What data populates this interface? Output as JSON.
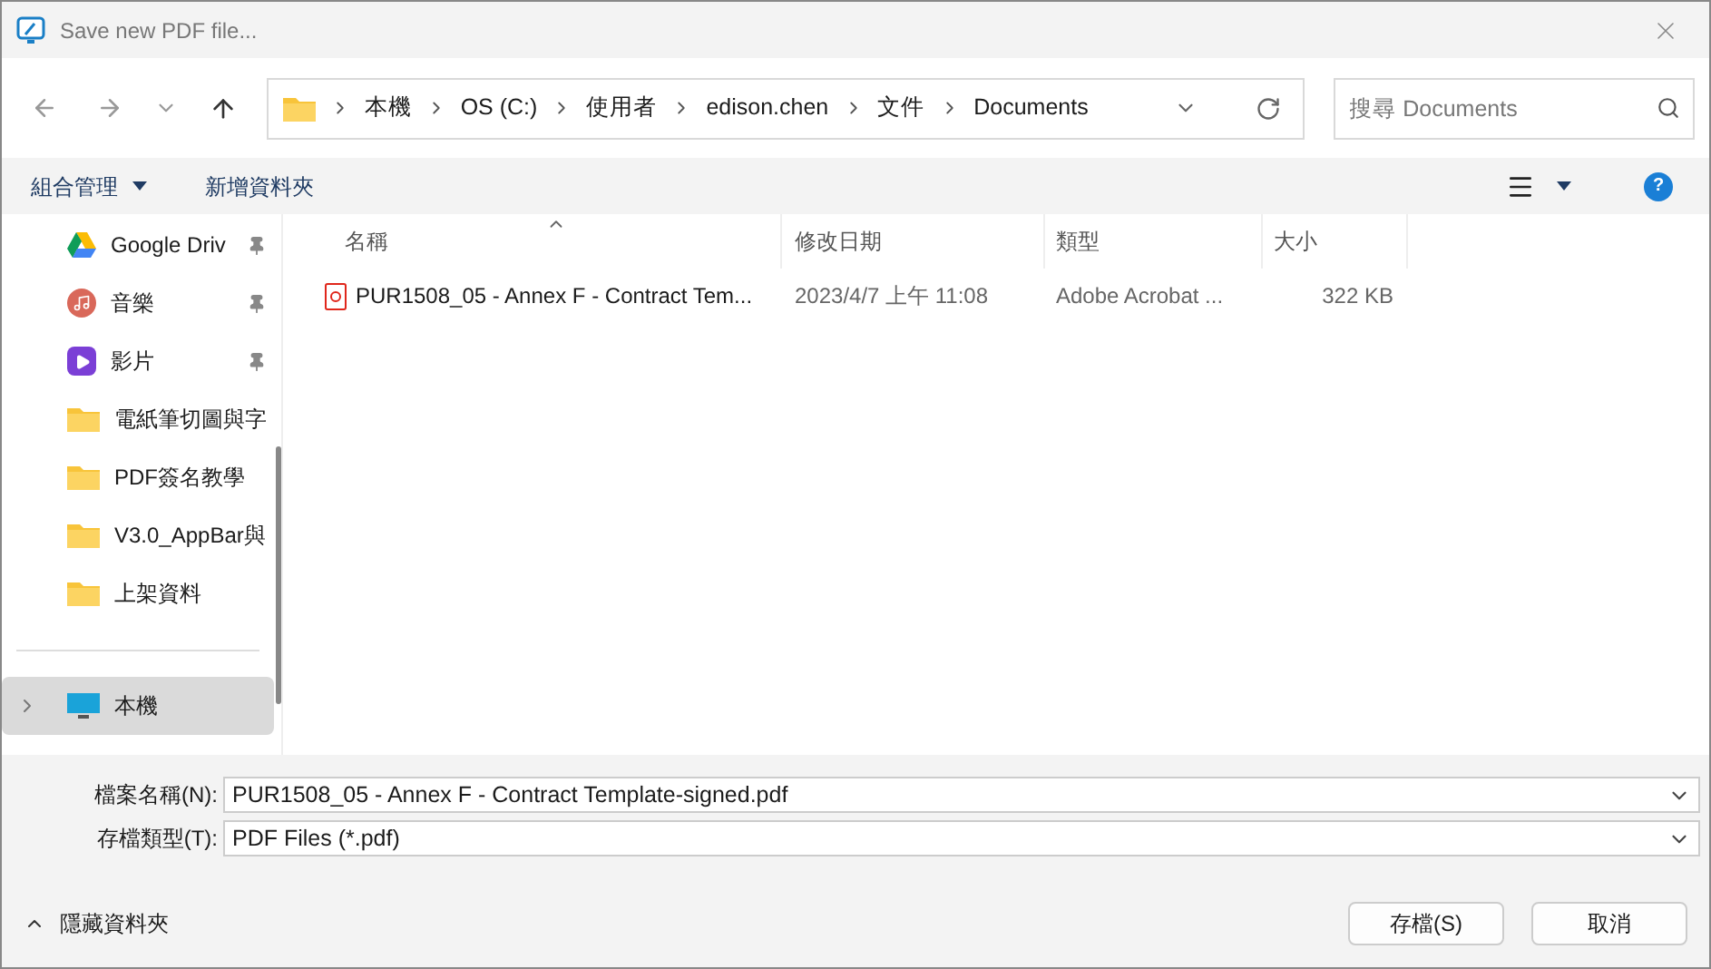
{
  "window": {
    "title": "Save new PDF file..."
  },
  "address_bar": {
    "path": [
      "本機",
      "OS (C:)",
      "使用者",
      "edison.chen",
      "文件",
      "Documents"
    ]
  },
  "search": {
    "placeholder": "搜尋 Documents"
  },
  "toolbar": {
    "organize": "組合管理",
    "new_folder": "新增資料夾",
    "help": "?"
  },
  "sidebar": {
    "items": [
      {
        "kind": "drive",
        "label": "Google Driv",
        "pinned": true,
        "selected": false
      },
      {
        "kind": "music",
        "label": "音樂",
        "pinned": true,
        "selected": false
      },
      {
        "kind": "video",
        "label": "影片",
        "pinned": true,
        "selected": false
      },
      {
        "kind": "folder",
        "label": "電紙筆切圖與字",
        "pinned": false,
        "selected": false
      },
      {
        "kind": "folder",
        "label": "PDF簽名教學",
        "pinned": false,
        "selected": false
      },
      {
        "kind": "folder",
        "label": "V3.0_AppBar與",
        "pinned": false,
        "selected": false
      },
      {
        "kind": "folder",
        "label": "上架資料",
        "pinned": false,
        "selected": false
      },
      {
        "kind": "divider"
      },
      {
        "kind": "pc",
        "label": "本機",
        "pinned": false,
        "selected": true
      }
    ]
  },
  "table": {
    "columns": [
      "名稱",
      "修改日期",
      "類型",
      "大小"
    ],
    "rows": [
      {
        "name": "PUR1508_05 - Annex F - Contract Tem...",
        "modified": "2023/4/7 上午 11:08",
        "type": "Adobe Acrobat ...",
        "size": "322 KB"
      }
    ]
  },
  "form": {
    "filename_label": "檔案名稱(N):",
    "filename": "PUR1508_05 - Annex F - Contract Template-signed.pdf",
    "filetype_label": "存檔類型(T):",
    "filetype": "PDF Files (*.pdf)"
  },
  "footer": {
    "hide_folders": "隱藏資料夾",
    "buttons": [
      "存檔(S)",
      "取消"
    ]
  }
}
